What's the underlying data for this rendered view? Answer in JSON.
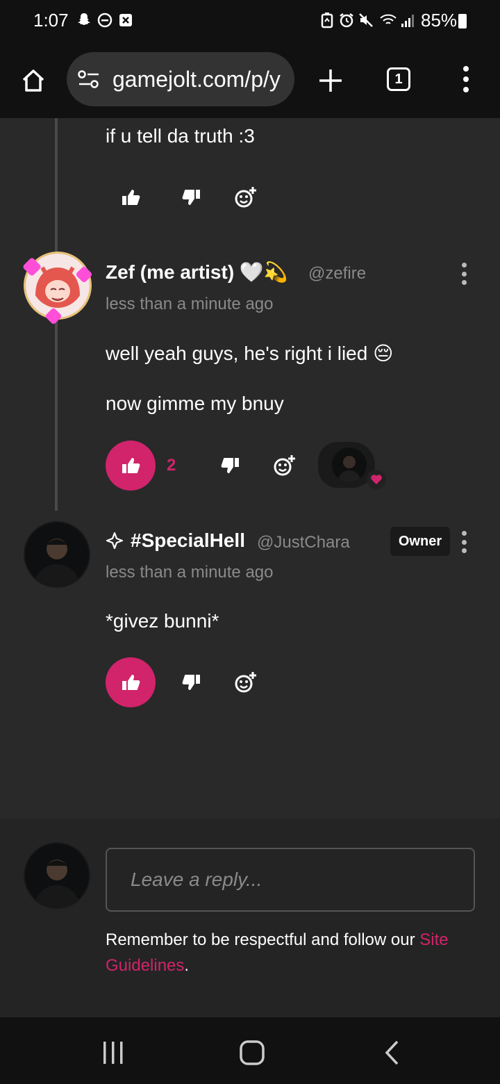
{
  "status": {
    "time": "1:07",
    "battery": "85%"
  },
  "browser": {
    "url": "gamejolt.com/p/y",
    "tab_count": "1"
  },
  "comments": [
    {
      "text": "if u tell da truth :3"
    },
    {
      "name": "Zef (me artist) 🤍💫",
      "handle": "@zefire",
      "time": "less than a minute ago",
      "line1": "well yeah guys, he's right i lied 😔",
      "line2": "now gimme my bnuy",
      "like_count": "2"
    },
    {
      "name": "#SpecialHell",
      "handle": "@JustChara",
      "badge": "Owner",
      "time": "less than a minute ago",
      "text": "*givez bunni*"
    }
  ],
  "reply": {
    "placeholder": "Leave a reply...",
    "notice": "Remember to be respectful and follow our ",
    "link": "Site Guidelines",
    "notice_end": "."
  },
  "colors": {
    "accent": "#d1246a",
    "background": "#292929"
  }
}
